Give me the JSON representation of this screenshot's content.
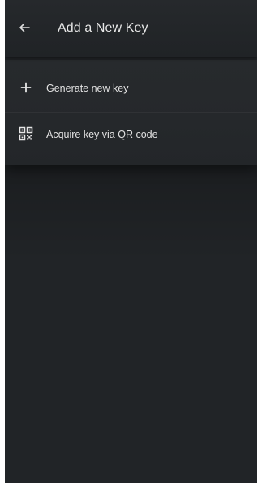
{
  "app": {
    "title": "Add a New Key",
    "back_icon": "arrow-left-icon"
  },
  "menu": {
    "items": [
      {
        "label": "Generate new key",
        "icon": "plus-icon"
      },
      {
        "label": "Acquire key via QR code",
        "icon": "qr-code-icon"
      }
    ]
  },
  "colors": {
    "background": "#212427",
    "text": "#e8e8e8"
  }
}
